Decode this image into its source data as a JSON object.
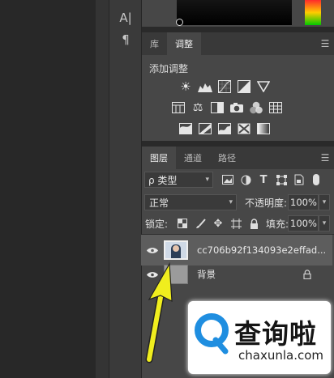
{
  "tools": {
    "text_tool": "A|",
    "paragraph_tool": "¶"
  },
  "adjust_panel": {
    "tabs": [
      {
        "label": "库",
        "active": false
      },
      {
        "label": "调整",
        "active": true
      }
    ],
    "title": "添加调整"
  },
  "layers_panel": {
    "tabs": [
      {
        "label": "图层",
        "active": true
      },
      {
        "label": "通道",
        "active": false
      },
      {
        "label": "路径",
        "active": false
      }
    ],
    "filter_kind": "ρ 类型",
    "blend_mode": "正常",
    "opacity_label": "不透明度:",
    "opacity_value": "100%",
    "lock_label": "锁定:",
    "fill_label": "填充:",
    "fill_value": "100%",
    "layers": [
      {
        "name": "cc706b92f134093e2effad...",
        "selected": true
      },
      {
        "name": "背景",
        "locked": true
      }
    ]
  },
  "watermark": {
    "cn": "查询啦",
    "url": "chaxunla.com"
  },
  "colors": {
    "panel_bg": "#474747",
    "selected_layer": "#5d5d5d",
    "arrow": "#f0ee1e",
    "watermark_blue": "#1f8ee0"
  }
}
